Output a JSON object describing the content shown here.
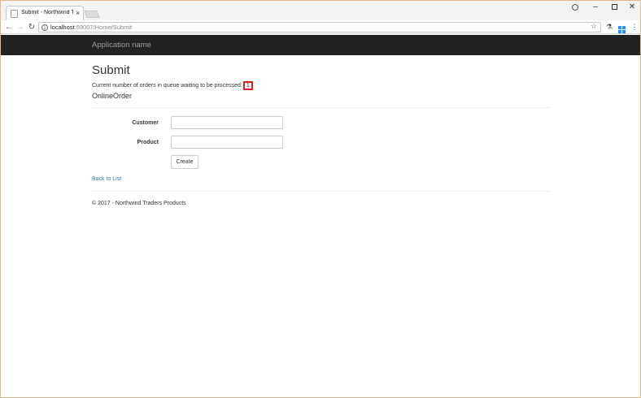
{
  "browser": {
    "tab_title": "Submit - Northwind Trad",
    "tab_close": "×",
    "url_host": "localhost",
    "url_port_path": ":59007/Home/Submit",
    "window_controls": {
      "minimize": "–",
      "close": "✕"
    },
    "icons": [
      "back-icon",
      "forward-icon",
      "reload-icon",
      "info-icon",
      "star-icon",
      "extension-icon",
      "windows-icon",
      "menu-icon",
      "profile-icon"
    ]
  },
  "navbar": {
    "brand": "Application name"
  },
  "page": {
    "title": "Submit",
    "queue_text": "Current number of orders in queue waiting to be processed:",
    "queue_count": "1",
    "section_title": "OnlineOrder"
  },
  "form": {
    "customer_label": "Customer",
    "customer_value": "",
    "product_label": "Product",
    "product_value": "",
    "create_label": "Create"
  },
  "links": {
    "back_to_list": "Back to List"
  },
  "footer": {
    "text": "© 2017 - Northwind Traders Products"
  },
  "colors": {
    "navbar": "#222222",
    "link": "#337ab7",
    "highlight": "#e0201d"
  }
}
